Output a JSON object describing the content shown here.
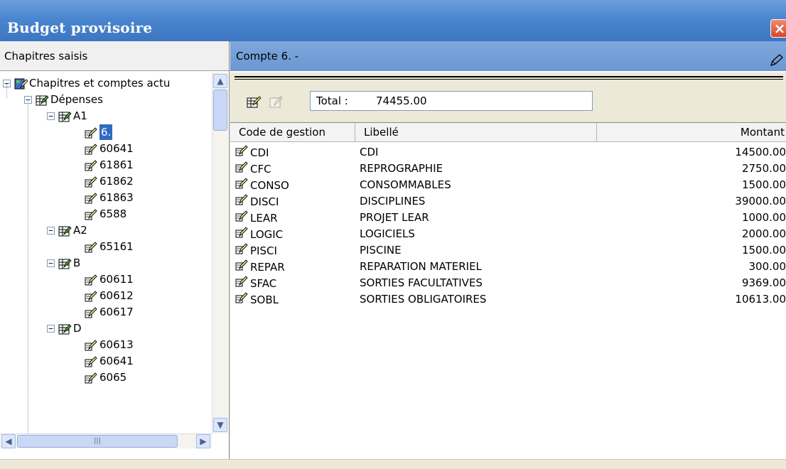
{
  "window": {
    "title": "Budget provisoire",
    "close_glyph": "×"
  },
  "left_pane": {
    "header": "Chapitres saisis",
    "tree": {
      "root": "Chapitres et comptes actu",
      "depenses": "Dépenses",
      "groups": [
        {
          "label": "A1",
          "items": [
            "6.",
            "60641",
            "61861",
            "61862",
            "61863",
            "6588"
          ]
        },
        {
          "label": "A2",
          "items": [
            "65161"
          ]
        },
        {
          "label": "B",
          "items": [
            "60611",
            "60612",
            "60617"
          ]
        },
        {
          "label": "D",
          "items": [
            "60613",
            "60641",
            "6065"
          ]
        }
      ],
      "selected": "6."
    }
  },
  "right_pane": {
    "header": "Compte 6. -",
    "total_label": "Total :",
    "total_value": "74455.00",
    "columns": [
      "Code de gestion",
      "Libellé",
      "Montant"
    ],
    "rows": [
      {
        "code": "CDI",
        "libelle": "CDI",
        "montant": "14500.00"
      },
      {
        "code": "CFC",
        "libelle": "REPROGRAPHIE",
        "montant": "2750.00"
      },
      {
        "code": "CONSO",
        "libelle": "CONSOMMABLES",
        "montant": "1500.00"
      },
      {
        "code": "DISCI",
        "libelle": "DISCIPLINES",
        "montant": "39000.00"
      },
      {
        "code": "LEAR",
        "libelle": "PROJET LEAR",
        "montant": "1000.00"
      },
      {
        "code": "LOGIC",
        "libelle": "LOGICIELS",
        "montant": "2000.00"
      },
      {
        "code": "PISCI",
        "libelle": "PISCINE",
        "montant": "1500.00"
      },
      {
        "code": "REPAR",
        "libelle": "REPARATION MATERIEL",
        "montant": "300.00"
      },
      {
        "code": "SFAC",
        "libelle": "SORTIES FACULTATIVES",
        "montant": "9369.00"
      },
      {
        "code": "SOBL",
        "libelle": "SORTIES OBLIGATOIRES",
        "montant": "10613.00"
      }
    ]
  },
  "colors": {
    "titlebar": "#4a86cf",
    "header_blue": "#7ea7dc",
    "selection": "#316ac5",
    "close": "#d6462a"
  }
}
